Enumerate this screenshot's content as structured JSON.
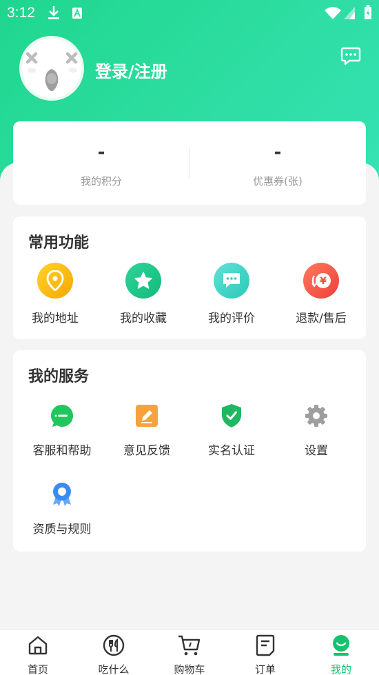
{
  "status_bar": {
    "time": "3:12"
  },
  "profile": {
    "login_text": "登录/注册"
  },
  "stats": [
    {
      "value": "-",
      "label": "我的积分"
    },
    {
      "value": "-",
      "label": "优惠券(张)"
    }
  ],
  "common_functions": {
    "title": "常用功能",
    "items": [
      {
        "label": "我的地址",
        "icon": "location-pin-icon",
        "color": "#f7b500"
      },
      {
        "label": "我的收藏",
        "icon": "star-icon",
        "color": "#20c68c"
      },
      {
        "label": "我的评价",
        "icon": "comment-icon",
        "color": "#37d2c4"
      },
      {
        "label": "退款/售后",
        "icon": "refund-yuan-icon",
        "color": "#f25a4c"
      }
    ]
  },
  "my_services": {
    "title": "我的服务",
    "items": [
      {
        "label": "客服和帮助",
        "icon": "customer-service-icon",
        "color": "#20c45e"
      },
      {
        "label": "意见反馈",
        "icon": "feedback-edit-icon",
        "color": "#f6a23b"
      },
      {
        "label": "实名认证",
        "icon": "shield-check-icon",
        "color": "#1fb860"
      },
      {
        "label": "设置",
        "icon": "gear-icon",
        "color": "#9a9a9a"
      },
      {
        "label": "资质与规则",
        "icon": "badge-ribbon-icon",
        "color": "#3b8cf2"
      }
    ]
  },
  "tab_bar": {
    "active_color": "#17c26f",
    "items": [
      {
        "label": "首页",
        "icon": "home-icon"
      },
      {
        "label": "吃什么",
        "icon": "fork-knife-icon"
      },
      {
        "label": "购物车",
        "icon": "cart-icon"
      },
      {
        "label": "订单",
        "icon": "order-doc-icon"
      },
      {
        "label": "我的",
        "icon": "profile-face-icon",
        "active": true
      }
    ]
  }
}
